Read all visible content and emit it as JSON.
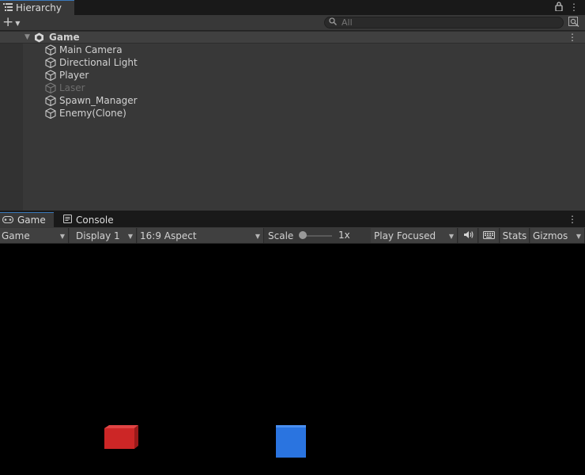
{
  "hierarchy": {
    "tab_label": "Hierarchy",
    "search_placeholder": "All",
    "scene": {
      "name": "Game"
    },
    "items": [
      {
        "label": "Main Camera",
        "enabled": true
      },
      {
        "label": "Directional Light",
        "enabled": true
      },
      {
        "label": "Player",
        "enabled": true
      },
      {
        "label": "Laser",
        "enabled": false
      },
      {
        "label": "Spawn_Manager",
        "enabled": true
      },
      {
        "label": "Enemy(Clone)",
        "enabled": true
      }
    ]
  },
  "game_view": {
    "tabs": [
      {
        "label": "Game",
        "icon": "gamepad-icon",
        "active": true
      },
      {
        "label": "Console",
        "icon": "console-icon",
        "active": false
      }
    ],
    "toolbar": {
      "mode": "Game",
      "display": "Display 1",
      "aspect": "16:9 Aspect",
      "scale_label": "Scale",
      "scale_value": "1x",
      "play_mode": "Play Focused",
      "stats": "Stats",
      "gizmos": "Gizmos"
    },
    "scene_objects": [
      {
        "name": "enemy-cube",
        "color": "#d02a2a"
      },
      {
        "name": "player-cube",
        "color": "#2a76e0"
      }
    ]
  },
  "colors": {
    "panel_bg": "#383838",
    "tab_bar_bg": "#191919",
    "active_tab_accent": "#3a79bb",
    "viewport_bg": "#000000"
  }
}
